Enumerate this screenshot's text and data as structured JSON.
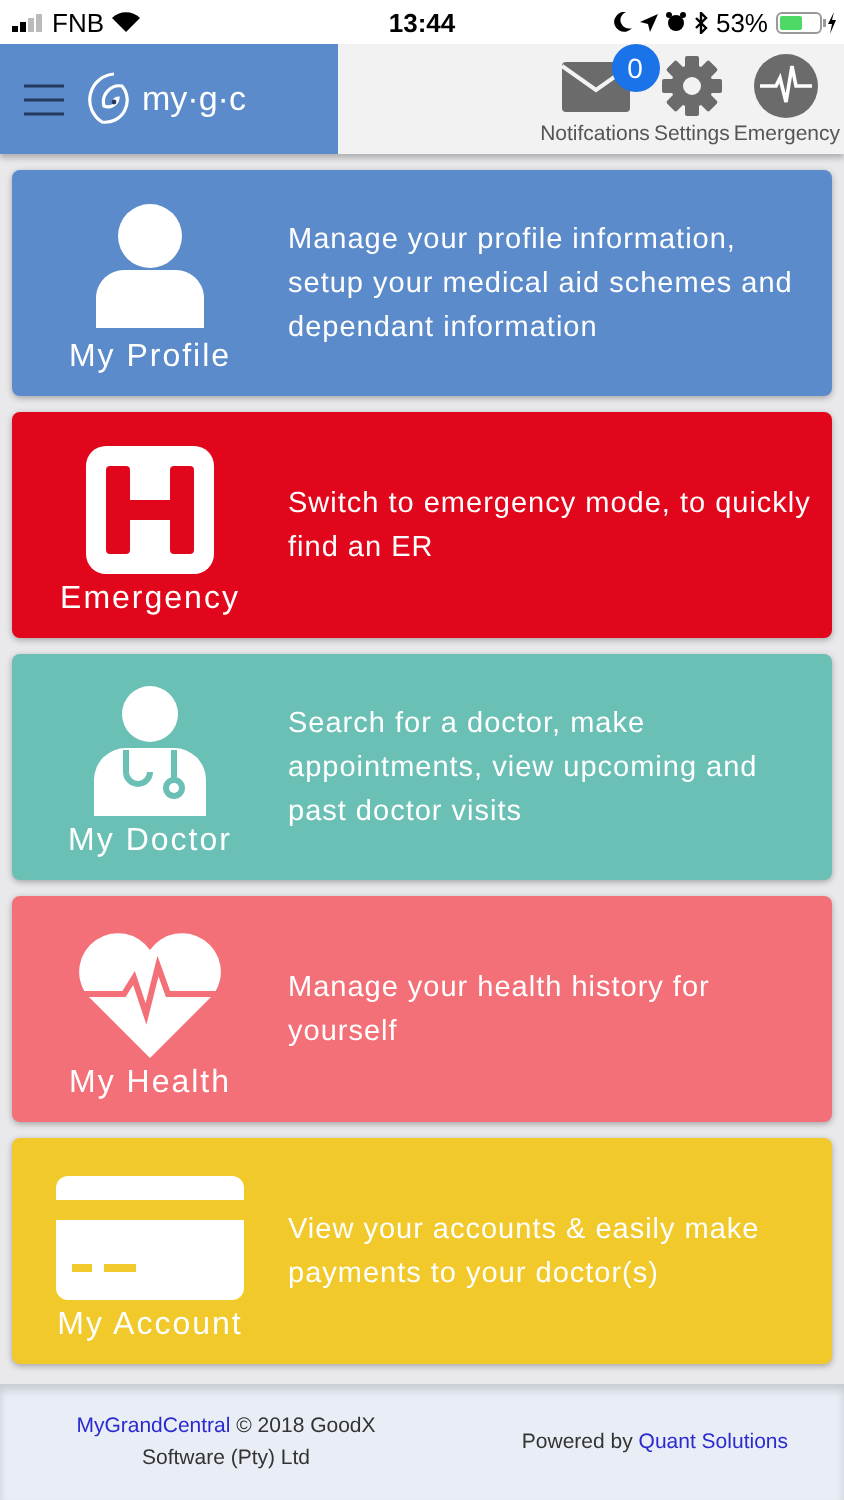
{
  "status_bar": {
    "carrier": "FNB",
    "time": "13:44",
    "battery": "53%"
  },
  "header": {
    "logo": "my·g·c",
    "actions": [
      {
        "kind": "mail",
        "label": "Notifcations",
        "badge": "0"
      },
      {
        "kind": "gear",
        "label": "Settings"
      },
      {
        "kind": "pulse",
        "label": "Emergency"
      }
    ]
  },
  "cards": [
    {
      "kind": "profile",
      "title": "My Profile",
      "description": "Manage your profile information, setup your medical aid schemes and dependant information",
      "color": "#5b8bca"
    },
    {
      "kind": "hospital",
      "title": "Emergency",
      "description": "Switch to emergency mode, to quickly find an ER",
      "color": "#e1061b"
    },
    {
      "kind": "doctor",
      "title": "My Doctor",
      "description": "Search for a doctor, make appointments, view upcoming and past doctor visits",
      "color": "#6bc0b6"
    },
    {
      "kind": "heart",
      "title": "My Health",
      "description": "Manage your health history for yourself",
      "color": "#f47079"
    },
    {
      "kind": "card",
      "title": "My Account",
      "description": "View your accounts & easily make payments to your doctor(s)",
      "color": "#f2c92a"
    }
  ],
  "footer": {
    "brand_link": "MyGrandCentral",
    "copyright": "© 2018 GoodX Software (Pty) Ltd",
    "powered_by": "Powered by",
    "company_link": "Quant Solutions"
  }
}
